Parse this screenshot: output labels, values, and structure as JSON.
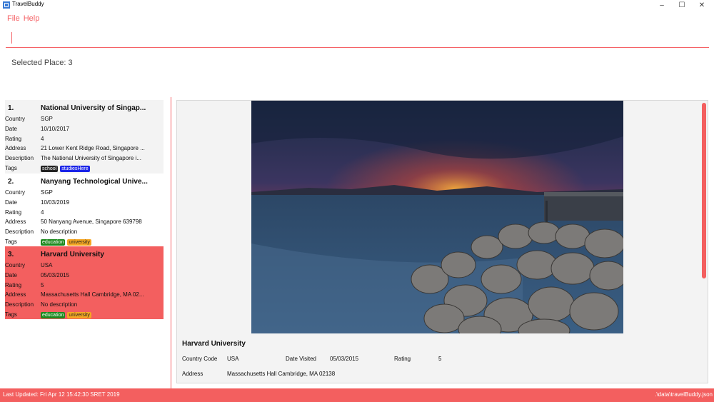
{
  "window": {
    "title": "TravelBuddy",
    "minimize": "–",
    "maximize": "☐",
    "close": "✕"
  },
  "menu": {
    "file": "File",
    "help": "Help"
  },
  "command": {
    "value": ""
  },
  "result_display": "Selected Place: 3",
  "places": [
    {
      "index": "1.",
      "name": "National University of Singap...",
      "country_label": "Country",
      "country": "SGP",
      "date_label": "Date",
      "date": "10/10/2017",
      "rating_label": "Rating",
      "rating": "4",
      "address_label": "Address",
      "address": "21 Lower Kent Ridge Road, Singapore ...",
      "description_label": "Description",
      "description": "The National University of Singapore i...",
      "tags_label": "Tags",
      "tags": [
        "school",
        "studiesHere"
      ]
    },
    {
      "index": "2.",
      "name": "Nanyang Technological Unive...",
      "country_label": "Country",
      "country": "SGP",
      "date_label": "Date",
      "date": "10/03/2019",
      "rating_label": "Rating",
      "rating": "4",
      "address_label": "Address",
      "address": "50 Nanyang Avenue, Singapore 639798",
      "description_label": "Description",
      "description": "No description",
      "tags_label": "Tags",
      "tags": [
        "education",
        "university"
      ]
    },
    {
      "index": "3.",
      "name": "Harvard University",
      "country_label": "Country",
      "country": "USA",
      "date_label": "Date",
      "date": "05/03/2015",
      "rating_label": "Rating",
      "rating": "5",
      "address_label": "Address",
      "address": "Massachusetts Hall Cambridge, MA 02...",
      "description_label": "Description",
      "description": "No description",
      "tags_label": "Tags",
      "tags": [
        "education",
        "university"
      ]
    }
  ],
  "detail": {
    "name": "Harvard University",
    "country_code_label": "Country Code",
    "country_code": "USA",
    "date_visited_label": "Date Visited",
    "date_visited": "05/03/2015",
    "rating_label": "Rating",
    "rating": "5",
    "address_label": "Address",
    "address": "Massachusetts Hall Cambridge, MA 02138"
  },
  "status": {
    "last_updated": "Last Updated: Fri Apr 12 15:42:30 SRET 2019",
    "file_path": ".\\data\\travelBuddy.json"
  },
  "colors": {
    "accent": "#f35f5f",
    "menu_text": "#f56266",
    "tag_school": "#222222",
    "tag_studiesHere": "#1a24e8",
    "tag_education": "#1d8a1f",
    "tag_university": "#f5a623"
  },
  "icons": {
    "app": "travelbuddy-app-icon"
  }
}
